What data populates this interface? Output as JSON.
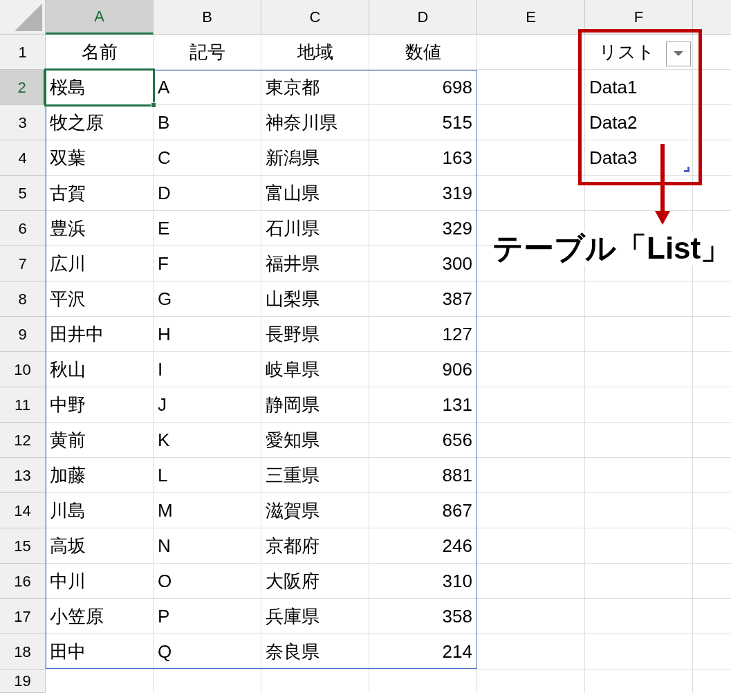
{
  "column_headers": [
    {
      "label": "A",
      "selected": true
    },
    {
      "label": "B",
      "selected": false
    },
    {
      "label": "C",
      "selected": false
    },
    {
      "label": "D",
      "selected": false
    },
    {
      "label": "E",
      "selected": false
    },
    {
      "label": "F",
      "selected": false
    }
  ],
  "rows": [
    {
      "number": "1",
      "selected": false,
      "kind": "header",
      "name": "名前",
      "code": "記号",
      "region": "地域",
      "value": "数値",
      "list": "リスト"
    },
    {
      "number": "2",
      "selected": true,
      "kind": "data",
      "name": "桜島",
      "code": "A",
      "region": "東京都",
      "value": "698",
      "list": "Data1"
    },
    {
      "number": "3",
      "selected": false,
      "kind": "data",
      "name": "牧之原",
      "code": "B",
      "region": "神奈川県",
      "value": "515",
      "list": "Data2"
    },
    {
      "number": "4",
      "selected": false,
      "kind": "data",
      "name": "双葉",
      "code": "C",
      "region": "新潟県",
      "value": "163",
      "list": "Data3"
    },
    {
      "number": "5",
      "selected": false,
      "kind": "data",
      "name": "古賀",
      "code": "D",
      "region": "富山県",
      "value": "319"
    },
    {
      "number": "6",
      "selected": false,
      "kind": "data",
      "name": "豊浜",
      "code": "E",
      "region": "石川県",
      "value": "329"
    },
    {
      "number": "7",
      "selected": false,
      "kind": "data",
      "name": "広川",
      "code": "F",
      "region": "福井県",
      "value": "300"
    },
    {
      "number": "8",
      "selected": false,
      "kind": "data",
      "name": "平沢",
      "code": "G",
      "region": "山梨県",
      "value": "387"
    },
    {
      "number": "9",
      "selected": false,
      "kind": "data",
      "name": "田井中",
      "code": "H",
      "region": "長野県",
      "value": "127"
    },
    {
      "number": "10",
      "selected": false,
      "kind": "data",
      "name": "秋山",
      "code": "I",
      "region": "岐阜県",
      "value": "906"
    },
    {
      "number": "11",
      "selected": false,
      "kind": "data",
      "name": "中野",
      "code": "J",
      "region": "静岡県",
      "value": "131"
    },
    {
      "number": "12",
      "selected": false,
      "kind": "data",
      "name": "黄前",
      "code": "K",
      "region": "愛知県",
      "value": "656"
    },
    {
      "number": "13",
      "selected": false,
      "kind": "data",
      "name": "加藤",
      "code": "L",
      "region": "三重県",
      "value": "881"
    },
    {
      "number": "14",
      "selected": false,
      "kind": "data",
      "name": "川島",
      "code": "M",
      "region": "滋賀県",
      "value": "867"
    },
    {
      "number": "15",
      "selected": false,
      "kind": "data",
      "name": "高坂",
      "code": "N",
      "region": "京都府",
      "value": "246"
    },
    {
      "number": "16",
      "selected": false,
      "kind": "data",
      "name": "中川",
      "code": "O",
      "region": "大阪府",
      "value": "310"
    },
    {
      "number": "17",
      "selected": false,
      "kind": "data",
      "name": "小笠原",
      "code": "P",
      "region": "兵庫県",
      "value": "358"
    },
    {
      "number": "18",
      "selected": false,
      "kind": "data",
      "name": "田中",
      "code": "Q",
      "region": "奈良県",
      "value": "214"
    },
    {
      "number": "19",
      "selected": false,
      "kind": "data"
    }
  ],
  "annotation": {
    "label": "テーブル「List」"
  }
}
